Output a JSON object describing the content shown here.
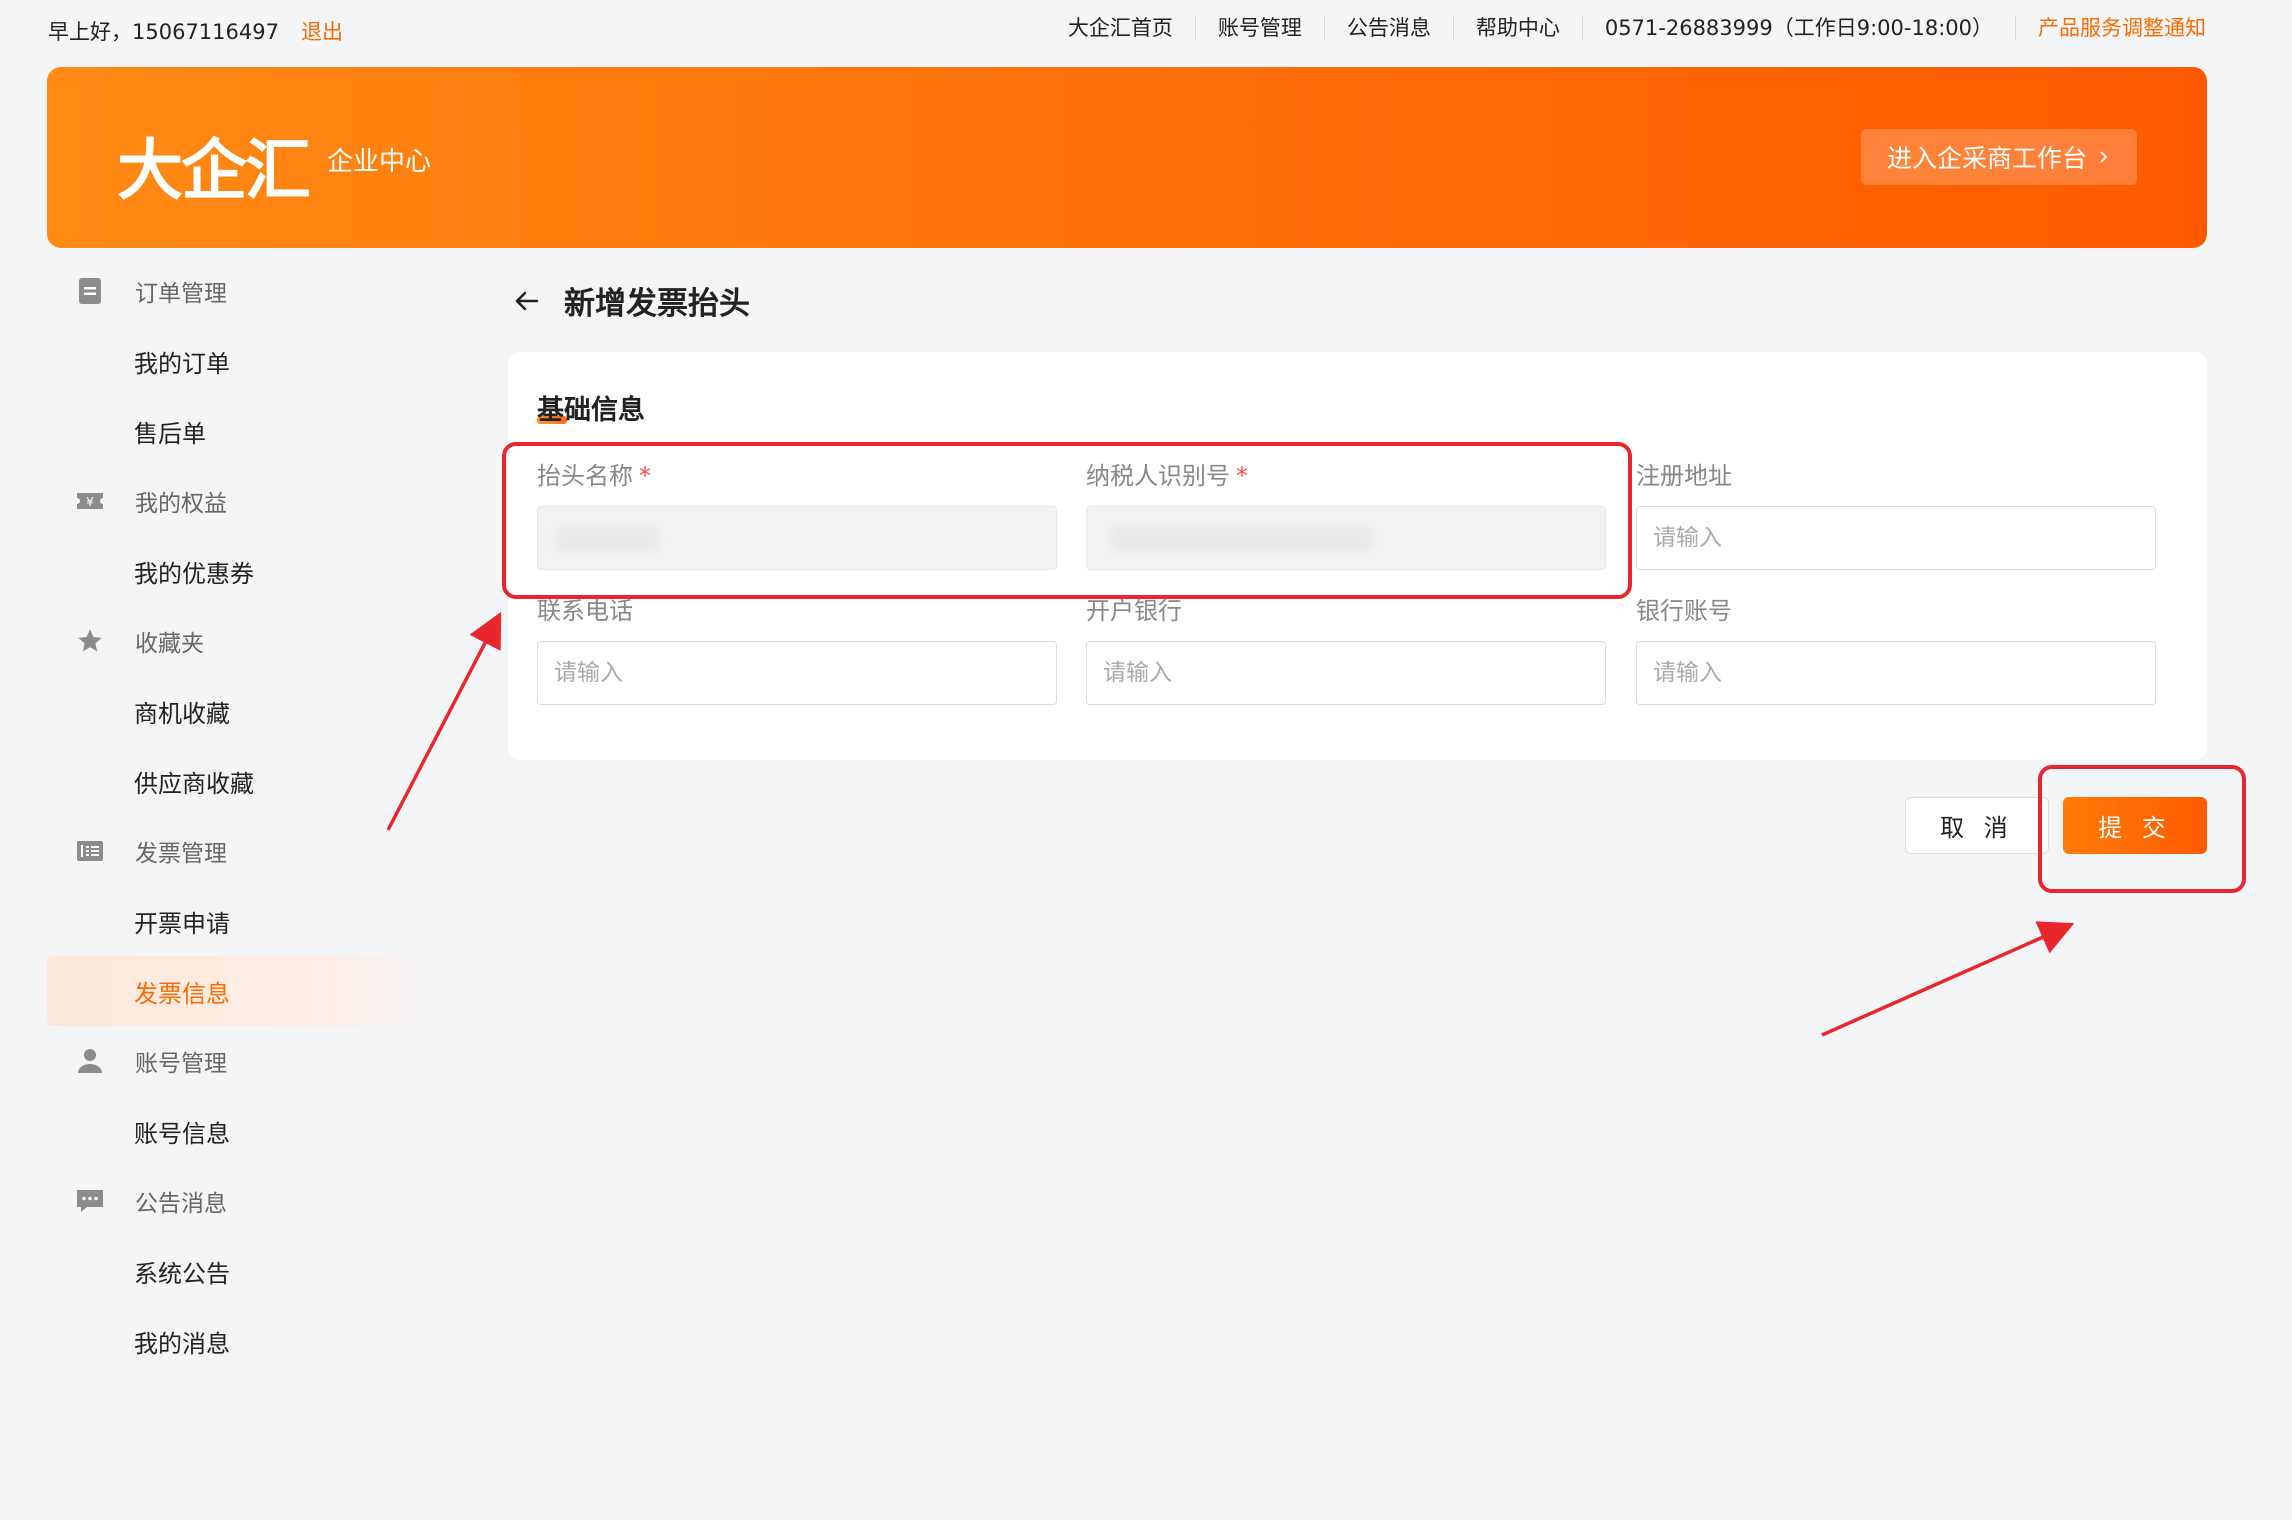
{
  "topbar": {
    "greeting": "早上好，15067116497",
    "logout": "退出",
    "nav": [
      "大企汇首页",
      "账号管理",
      "公告消息",
      "帮助中心",
      "0571-26883999（工作日9:00-18:00）"
    ],
    "notice": "产品服务调整通知"
  },
  "banner": {
    "logo": "大企汇",
    "subtitle": "企业中心",
    "workbench_button": "进入企采商工作台"
  },
  "sidebar": {
    "groups": [
      {
        "title": "订单管理",
        "icon": "document-icon",
        "items": [
          "我的订单",
          "售后单"
        ]
      },
      {
        "title": "我的权益",
        "icon": "coupon-icon",
        "items": [
          "我的优惠券"
        ]
      },
      {
        "title": "收藏夹",
        "icon": "star-icon",
        "items": [
          "商机收藏",
          "供应商收藏"
        ]
      },
      {
        "title": "发票管理",
        "icon": "invoice-icon",
        "items": [
          "开票申请",
          "发票信息"
        ]
      },
      {
        "title": "账号管理",
        "icon": "user-icon",
        "items": [
          "账号信息"
        ]
      },
      {
        "title": "公告消息",
        "icon": "message-icon",
        "items": [
          "系统公告",
          "我的消息"
        ]
      }
    ],
    "active_item": "发票信息"
  },
  "main": {
    "page_title": "新增发票抬头",
    "section_title": "基础信息",
    "fields": {
      "title_name": {
        "label": "抬头名称",
        "required_mark": "*",
        "value": ""
      },
      "tax_id": {
        "label": "纳税人识别号",
        "required_mark": "*",
        "value": ""
      },
      "address": {
        "label": "注册地址",
        "placeholder": "请输入"
      },
      "phone": {
        "label": "联系电话",
        "placeholder": "请输入"
      },
      "bank": {
        "label": "开户银行",
        "placeholder": "请输入"
      },
      "account": {
        "label": "银行账号",
        "placeholder": "请输入"
      }
    },
    "cancel_label": "取 消",
    "submit_label": "提 交"
  },
  "colors": {
    "brand": "#ff6a00",
    "annotation": "#e8262b"
  }
}
